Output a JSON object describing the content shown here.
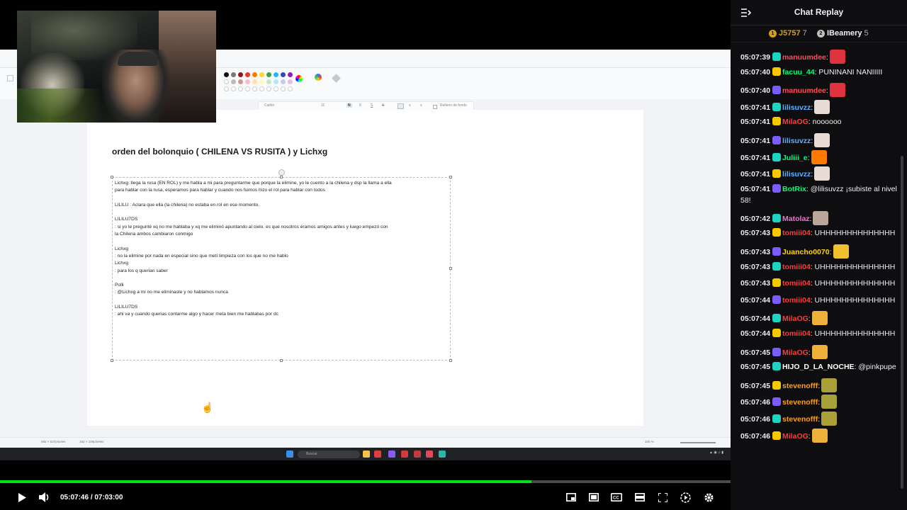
{
  "chat": {
    "title": "Chat Replay",
    "leaderboard": [
      {
        "rank": "1",
        "name": "J5757",
        "count": "7",
        "color": "#d4a017"
      },
      {
        "rank": "2",
        "name": "IBeamery",
        "count": "5",
        "color": "#c0c0c0"
      }
    ],
    "messages": [
      {
        "ts": "05:07:39",
        "user": "manuumdee",
        "color": "#ff4d57",
        "sep": ":",
        "text": "",
        "emote": "#e0313e"
      },
      {
        "ts": "05:07:40",
        "user": "facuu_44",
        "color": "#00ff7f",
        "sep": ":",
        "text": " PUNINANI NANIIIII",
        "emote": ""
      },
      {
        "ts": "05:07:40",
        "user": "manuumdee",
        "color": "#ff4d57",
        "sep": ":",
        "text": "",
        "emote": "#e0313e"
      },
      {
        "ts": "05:07:41",
        "user": "lilisuvzz",
        "color": "#5fb1ff",
        "sep": ":",
        "text": "",
        "emote": "#e8dcd4"
      },
      {
        "ts": "05:07:41",
        "user": "MilaOG",
        "color": "#ff3c3c",
        "sep": ":",
        "text": " noooooo",
        "emote": ""
      },
      {
        "ts": "05:07:41",
        "user": "lilisuvzz",
        "color": "#5fb1ff",
        "sep": ":",
        "text": "",
        "emote": "#e8dcd4"
      },
      {
        "ts": "05:07:41",
        "user": "Juliii_e",
        "color": "#00ff7f",
        "sep": ":",
        "text": "",
        "emote": "#ff7a00"
      },
      {
        "ts": "05:07:41",
        "user": "lilisuvzz",
        "color": "#5fb1ff",
        "sep": ":",
        "text": "",
        "emote": "#e8dcd4"
      },
      {
        "ts": "05:07:41",
        "user": "BotRix",
        "color": "#00ff7f",
        "sep": ":",
        "text": " @lilisuvzz ¡subiste al nivel 58!",
        "emote": ""
      },
      {
        "ts": "05:07:42",
        "user": "Matolaz",
        "color": "#ff6ad5",
        "sep": ":",
        "text": "",
        "emote": "#b9a59a"
      },
      {
        "ts": "05:07:43",
        "user": "tomiii04",
        "color": "#ff3c3c",
        "sep": ":",
        "text": " UHHHHHHHHHHHHHH",
        "emote": ""
      },
      {
        "ts": "05:07:43",
        "user": "Juancho0070",
        "color": "#ffd500",
        "sep": ":",
        "text": "",
        "emote": "#f0c030"
      },
      {
        "ts": "05:07:43",
        "user": "tomiii04",
        "color": "#ff3c3c",
        "sep": ":",
        "text": " UHHHHHHHHHHHHHH",
        "emote": ""
      },
      {
        "ts": "05:07:43",
        "user": "tomiii04",
        "color": "#ff3c3c",
        "sep": ":",
        "text": " UHHHHHHHHHHHHHH",
        "emote": ""
      },
      {
        "ts": "05:07:44",
        "user": "tomiii04",
        "color": "#ff3c3c",
        "sep": ":",
        "text": " UHHHHHHHHHHHHHH",
        "emote": ""
      },
      {
        "ts": "05:07:44",
        "user": "MilaOG",
        "color": "#ff3c3c",
        "sep": ":",
        "text": "",
        "emote": "#f0b13a"
      },
      {
        "ts": "05:07:44",
        "user": "tomiii04",
        "color": "#ff3c3c",
        "sep": ":",
        "text": " UHHHHHHHHHHHHHH",
        "emote": ""
      },
      {
        "ts": "05:07:45",
        "user": "MilaOG",
        "color": "#ff3c3c",
        "sep": ":",
        "text": "",
        "emote": "#f0b13a"
      },
      {
        "ts": "05:07:45",
        "user": "HIJO_D_LA_NOCHE",
        "color": "#ffffff",
        "sep": ":",
        "text": " @pinkpupe",
        "emote": ""
      },
      {
        "ts": "05:07:45",
        "user": "stevenofff",
        "color": "#ff9f1a",
        "sep": ":",
        "text": "",
        "emote": "#a9a03a"
      },
      {
        "ts": "05:07:46",
        "user": "stevenofff",
        "color": "#ff9f1a",
        "sep": ":",
        "text": "",
        "emote": "#a9a03a"
      },
      {
        "ts": "05:07:46",
        "user": "stevenofff",
        "color": "#ff9f1a",
        "sep": ":",
        "text": "",
        "emote": "#a9a03a"
      },
      {
        "ts": "05:07:46",
        "user": "MilaOG",
        "color": "#ff3c3c",
        "sep": ":",
        "text": "",
        "emote": "#f0b13a"
      }
    ]
  },
  "player": {
    "current_time": "05:07:46",
    "separator": "/",
    "duration": "07:03:00",
    "progress_fraction": 0.727,
    "accent": "#00e51b"
  },
  "document": {
    "title": "orden del bolonquio ( CHILENA VS RUSITA ) y Lichxg",
    "lines": [
      "Lichxg :llega la rusa (EN ROL) y me habla a mi para preguntarme que porque la elimine, yo le cuento a la chilena y dsp la llama a ella",
      "para hablar con la rusa, esperamos para hablar y cuando nos fuimos hizo el rol para hablar con todos",
      "",
      "LILILU : Aclara que ella (la chilena) no estaba en rol en ese momento.",
      "",
      "LILILU7DS",
      ": si yo le pregunté xq no me hablaba y xq me eliminó apuntando al cielo. es que nosotros éramos amigos antes y luego empezó con",
      "la Chilena ambos cambiaron conmigo",
      "",
      "Lichxg",
      ": no la elimine por nada en especial sino que metí limpieza con los que no me hablo",
      "Lichxg",
      ": para los q querian saber",
      "",
      "Polli",
      ": @Lichxg a mi no me eliminaste y no hablamos nunca",
      "",
      "LILILU7DS",
      ": ahi va y cuando querias contarme algo y hacer meta bien me hablabas por dc"
    ],
    "toolbar": {
      "font": "Calibri",
      "size": "11",
      "bold": "N",
      "italic": "K",
      "underline": "S",
      "strike": "S",
      "fill_label": "Relleno de fondo"
    },
    "status": {
      "pos1": "592 × 537píxeles",
      "pos2": "162 × 199píxeles",
      "zoom": "100 %"
    },
    "taskbar_search": "Buscar"
  }
}
